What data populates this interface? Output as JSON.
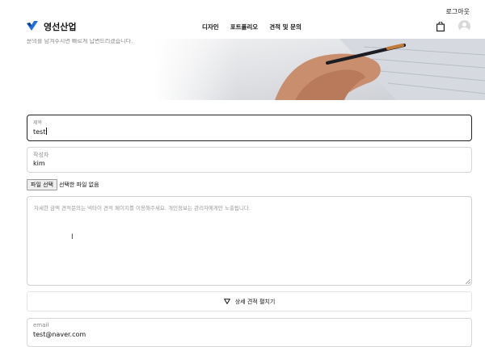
{
  "header": {
    "logout_label": "로그아웃",
    "brand_name": "영선산업",
    "nav": [
      "디자인",
      "포트폴리오",
      "견적 및 문의"
    ]
  },
  "hero": {
    "intro_text": "문의를 남겨주시면 빠르게 답변드리겠습니다."
  },
  "form": {
    "title_label": "제목",
    "title_value": "test",
    "author_label": "작성자",
    "author_value": "kim",
    "file_button_label": "파일 선택",
    "file_status": "선택한 파일 없음",
    "content_placeholder": "자세한 금액 견적문의는 넥타이 견적 페이지를 이용해주세요. 개인정보는 관리자에게만 노출됩니다.",
    "expand_label": "상세 견적 펼치기",
    "email_label": "email",
    "email_value": "test@naver.com"
  },
  "colors": {
    "brand_blue": "#1e6fd9",
    "focus_border": "#222222"
  }
}
